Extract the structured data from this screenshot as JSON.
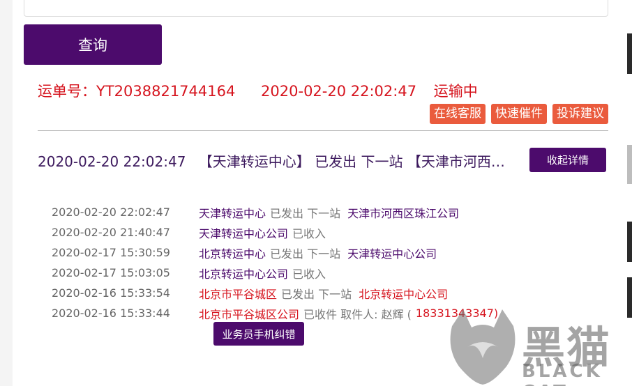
{
  "query": {
    "button_label": "查询"
  },
  "waybill": {
    "number_label": "运单号：YT2038821744164",
    "datetime": "2020-02-20  22:02:47",
    "status": "运输中"
  },
  "actions": [
    {
      "label": "在线客服"
    },
    {
      "label": "快速催件"
    },
    {
      "label": "投诉建议"
    }
  ],
  "summary": {
    "datetime": "2020-02-20  22:02:47",
    "text": "【天津转运中心】 已发出 下一站 【天津市河西区珠江公司】",
    "collapse_label": "收起详情"
  },
  "timeline": [
    {
      "time": "2020-02-20  22:02:47",
      "location": "天津转运中心",
      "status": "已发出 下一站",
      "next": "天津市河西区珠江公司",
      "phone": "",
      "red": false
    },
    {
      "time": "2020-02-20  21:40:47",
      "location": "天津转运中心公司",
      "status": "已收入",
      "next": "",
      "phone": "",
      "red": false
    },
    {
      "time": "2020-02-17  15:30:59",
      "location": "北京转运中心",
      "status": "已发出 下一站",
      "next": "天津转运中心公司",
      "phone": "",
      "red": false
    },
    {
      "time": "2020-02-17  15:03:05",
      "location": "北京转运中心公司",
      "status": "已收入",
      "next": "",
      "phone": "",
      "red": false
    },
    {
      "time": "2020-02-16  15:33:54",
      "location": "北京市平谷城区",
      "status": "已发出 下一站",
      "next": "北京转运中心公司",
      "phone": "",
      "red": true
    },
    {
      "time": "2020-02-16  15:33:44",
      "location": "北京市平谷城区公司",
      "status": "已收件 取件人: 赵辉 (",
      "next": "",
      "phone": "18331343347)",
      "red": true
    }
  ],
  "fix_button": {
    "label": "业务员手机纠错"
  },
  "watermark": {
    "title": "黑猫",
    "subtitle": "BLACK CAT"
  },
  "colors": {
    "brand_purple": "#4c0b6c",
    "alert_red": "#d6141e",
    "action_orange": "#ea5b3d"
  }
}
